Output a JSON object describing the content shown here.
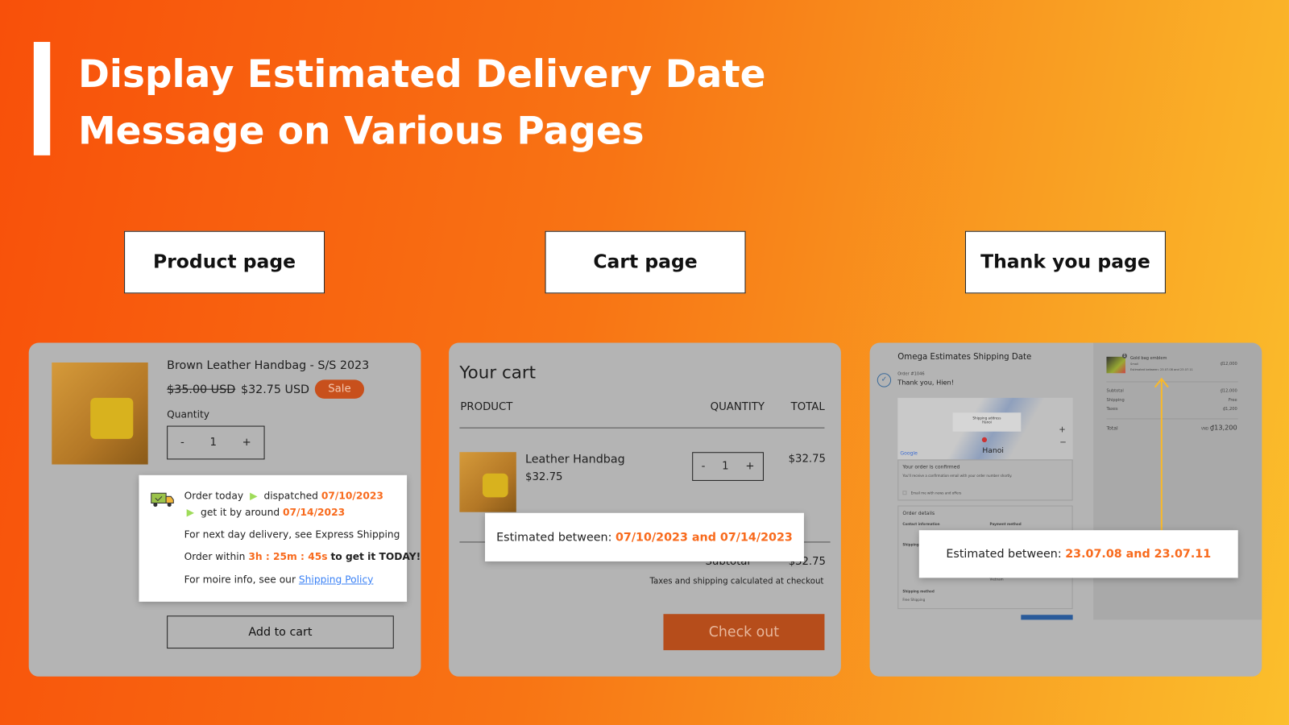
{
  "header": {
    "title_line1": "Display Estimated Delivery Date",
    "title_line2": "Message on Various Pages"
  },
  "labels": {
    "product": "Product page",
    "cart": "Cart page",
    "thankyou": "Thank you page"
  },
  "product": {
    "name": "Brown Leather Handbag - S/S 2023",
    "old_price": "$35.00 USD",
    "price": "$32.75 USD",
    "badge": "Sale",
    "quantity_label": "Quantity",
    "qty_minus": "-",
    "qty_value": "1",
    "qty_plus": "+",
    "popup": {
      "order_today": "Order today",
      "dispatched": "dispatched",
      "dispatch_date": "07/10/2023",
      "get_it": "get it by around",
      "arrive_date": "07/14/2023",
      "next_day": "For next day delivery, see Express Shipping",
      "order_within": "Order within",
      "countdown": "3h : 25m : 45s",
      "today": "to get it TODAY!",
      "more_info": "For moire info, see our",
      "policy_link": "Shipping Policy"
    },
    "add_to_cart": "Add to cart"
  },
  "cart": {
    "title": "Your cart",
    "col_product": "PRODUCT",
    "col_quantity": "QUANTITY",
    "col_total": "TOTAL",
    "item_name": "Leather Handbag",
    "item_price": "$32.75",
    "qty_minus": "-",
    "qty_value": "1",
    "qty_plus": "+",
    "item_total": "$32.75",
    "estimate_label": "Estimated between:",
    "estimate_value": "07/10/2023 and 07/14/2023",
    "subtotal_label": "Subtotal",
    "subtotal": "$32.75",
    "taxes_note": "Taxes and shipping calculated at checkout",
    "checkout": "Check out"
  },
  "thankyou": {
    "store": "Omega Estimates Shipping Date",
    "order_no": "Order #1046",
    "thanks": "Thank you, Hien!",
    "map_popup_title": "Shipping address",
    "map_popup_city": "Hanoi",
    "map_city": "Hanoi",
    "google": "Google",
    "confirmed": "Your order is confirmed",
    "confirmed_sub": "You'll receive a confirmation email with your order number shortly.",
    "email_opt": "Email me with news and offers",
    "order_details": "Order details",
    "contact": "Contact information",
    "payment": "Payment method",
    "shipping_address": "Shipping address",
    "country": "Vietnam",
    "shipping_method": "Shipping method",
    "free_shipping": "Free Shipping",
    "item_qty": "1",
    "item_name": "Gold bag emblem",
    "item_variant": "Small",
    "item_estimate": "Estimated between: 23.07.08 and 23.07.11",
    "item_price": "₫12,000",
    "subtotal_label": "Subtotal",
    "subtotal": "₫12,000",
    "shipping_label": "Shipping",
    "shipping": "Free",
    "taxes_label": "Taxes",
    "taxes": "₫1,200",
    "total_label": "Total",
    "currency": "VND",
    "total": "₫13,200",
    "estimate_label": "Estimated between:",
    "estimate_value": "23.07.08 and 23.07.11"
  },
  "colors": {
    "accent": "#f86a1c",
    "arrow": "#f9b92a",
    "checkout": "#b64d1b",
    "link": "#3b82f6"
  }
}
